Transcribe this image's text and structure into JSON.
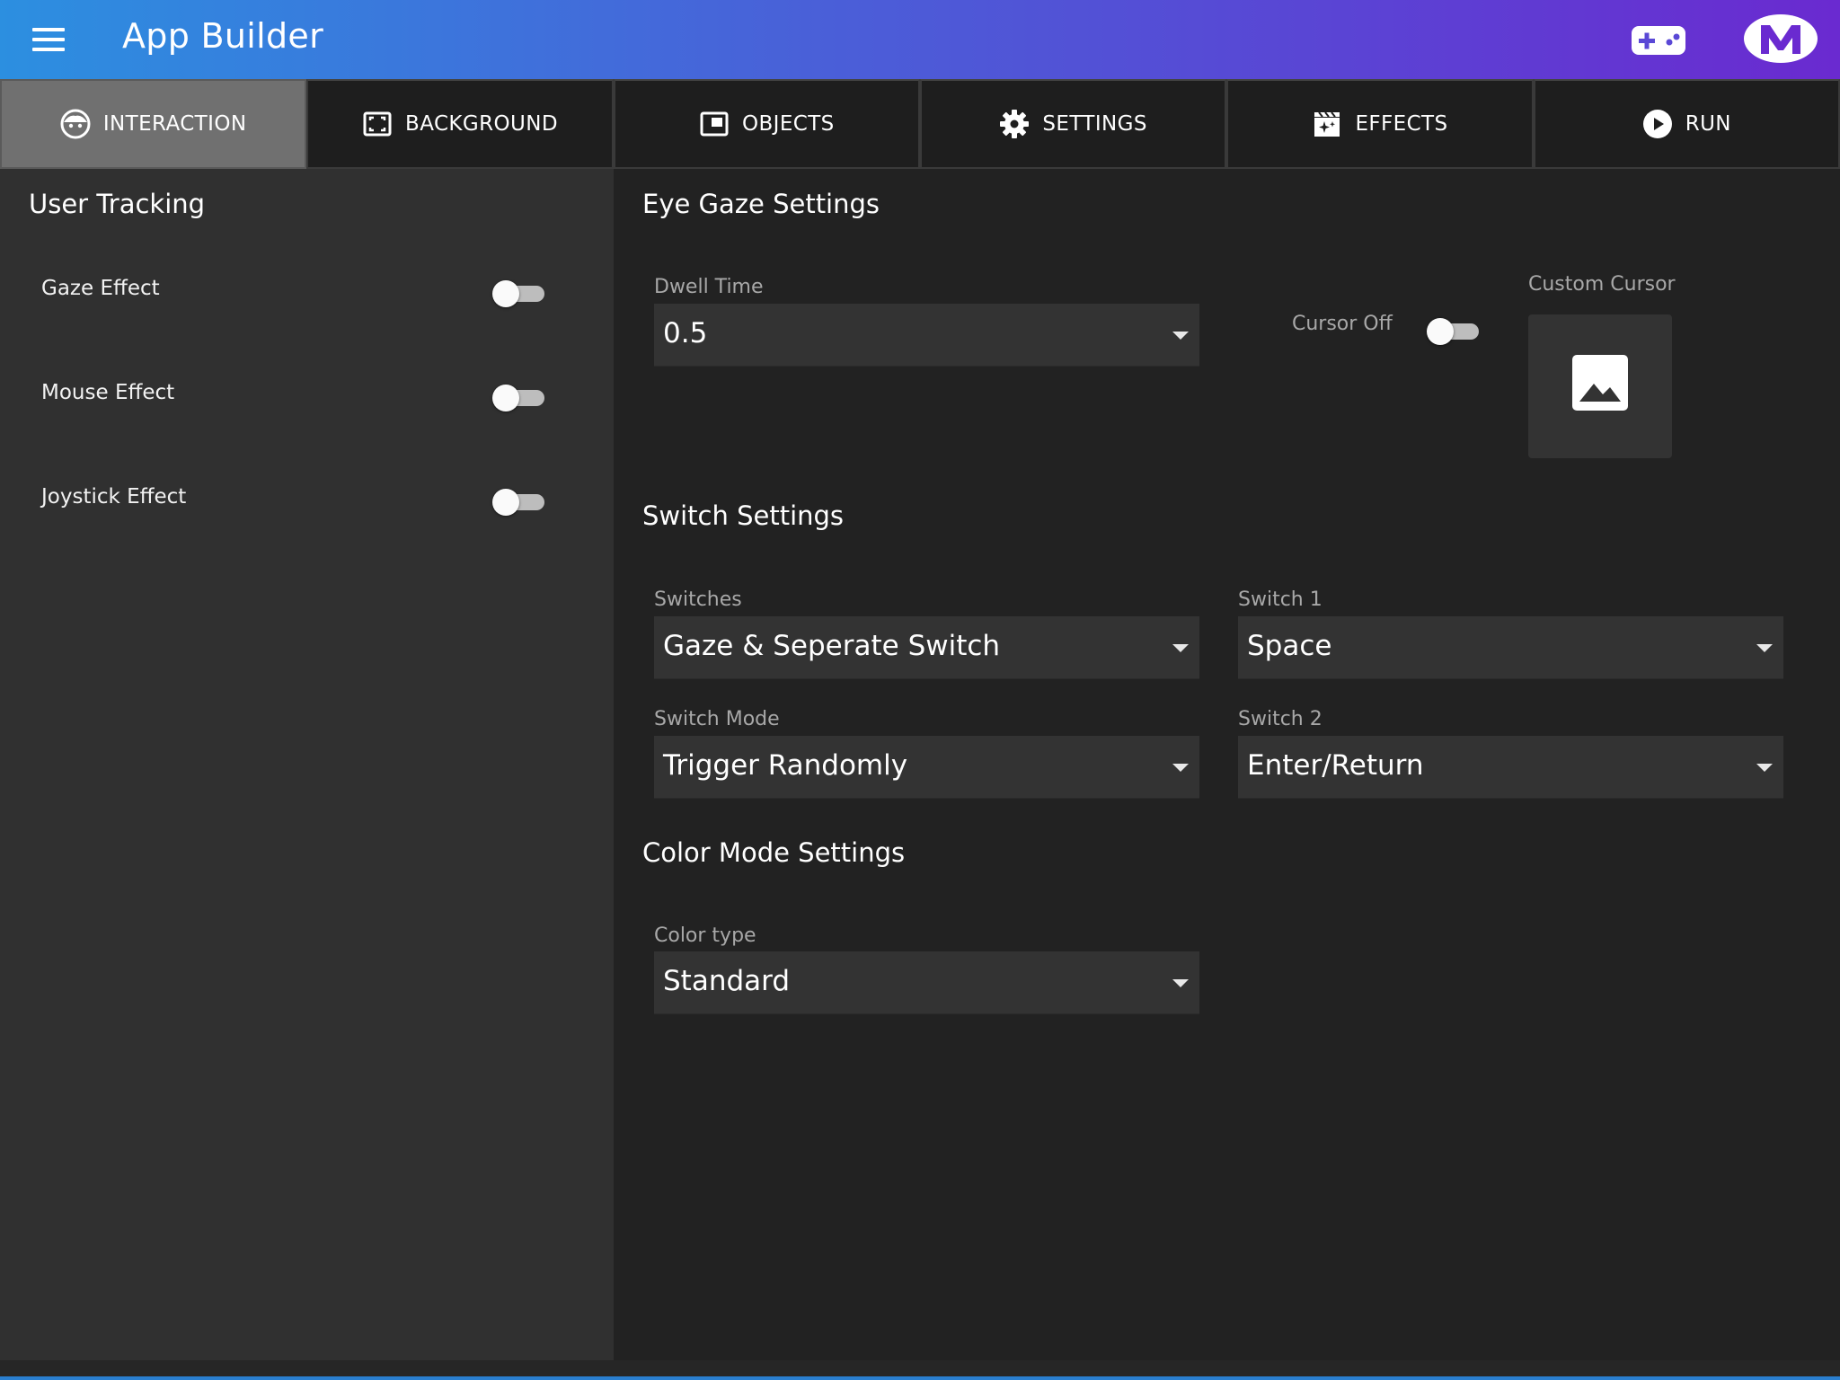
{
  "appbar": {
    "title": "App Builder",
    "menu_icon": "hamburger-menu-icon",
    "gamepad_icon": "gamepad-icon",
    "logo_icon": "m-logo-icon"
  },
  "tabs": [
    {
      "label": "INTERACTION",
      "icon": "face-icon",
      "active": true
    },
    {
      "label": "BACKGROUND",
      "icon": "fullscreen-frame-icon",
      "active": false
    },
    {
      "label": "OBJECTS",
      "icon": "picture-in-picture-icon",
      "active": false
    },
    {
      "label": "SETTINGS",
      "icon": "gear-icon",
      "active": false
    },
    {
      "label": "EFFECTS",
      "icon": "clapperboard-sparkle-icon",
      "active": false
    },
    {
      "label": "RUN",
      "icon": "play-circle-icon",
      "active": false
    }
  ],
  "user_tracking": {
    "title": "User Tracking",
    "items": [
      {
        "label": "Gaze Effect",
        "on": false
      },
      {
        "label": "Mouse Effect",
        "on": false
      },
      {
        "label": "Joystick Effect",
        "on": false
      }
    ]
  },
  "eye_gaze": {
    "title": "Eye Gaze Settings",
    "dwell_label": "Dwell Time",
    "dwell_value": "0.5",
    "cursor_off_label": "Cursor Off",
    "cursor_off_on": false,
    "custom_cursor_label": "Custom Cursor"
  },
  "switch_settings": {
    "title": "Switch Settings",
    "switches_label": "Switches",
    "switches_value": "Gaze & Seperate Switch",
    "switch1_label": "Switch 1",
    "switch1_value": "Space",
    "mode_label": "Switch Mode",
    "mode_value": "Trigger Randomly",
    "switch2_label": "Switch 2",
    "switch2_value": "Enter/Return"
  },
  "color_mode": {
    "title": "Color Mode Settings",
    "type_label": "Color type",
    "type_value": "Standard"
  },
  "colors": {
    "appbar_gradient_start": "#2c8fe0",
    "appbar_gradient_end": "#6a2ad0",
    "active_tab": "#707070",
    "panel_bg": "#303030",
    "main_bg": "#222222"
  }
}
